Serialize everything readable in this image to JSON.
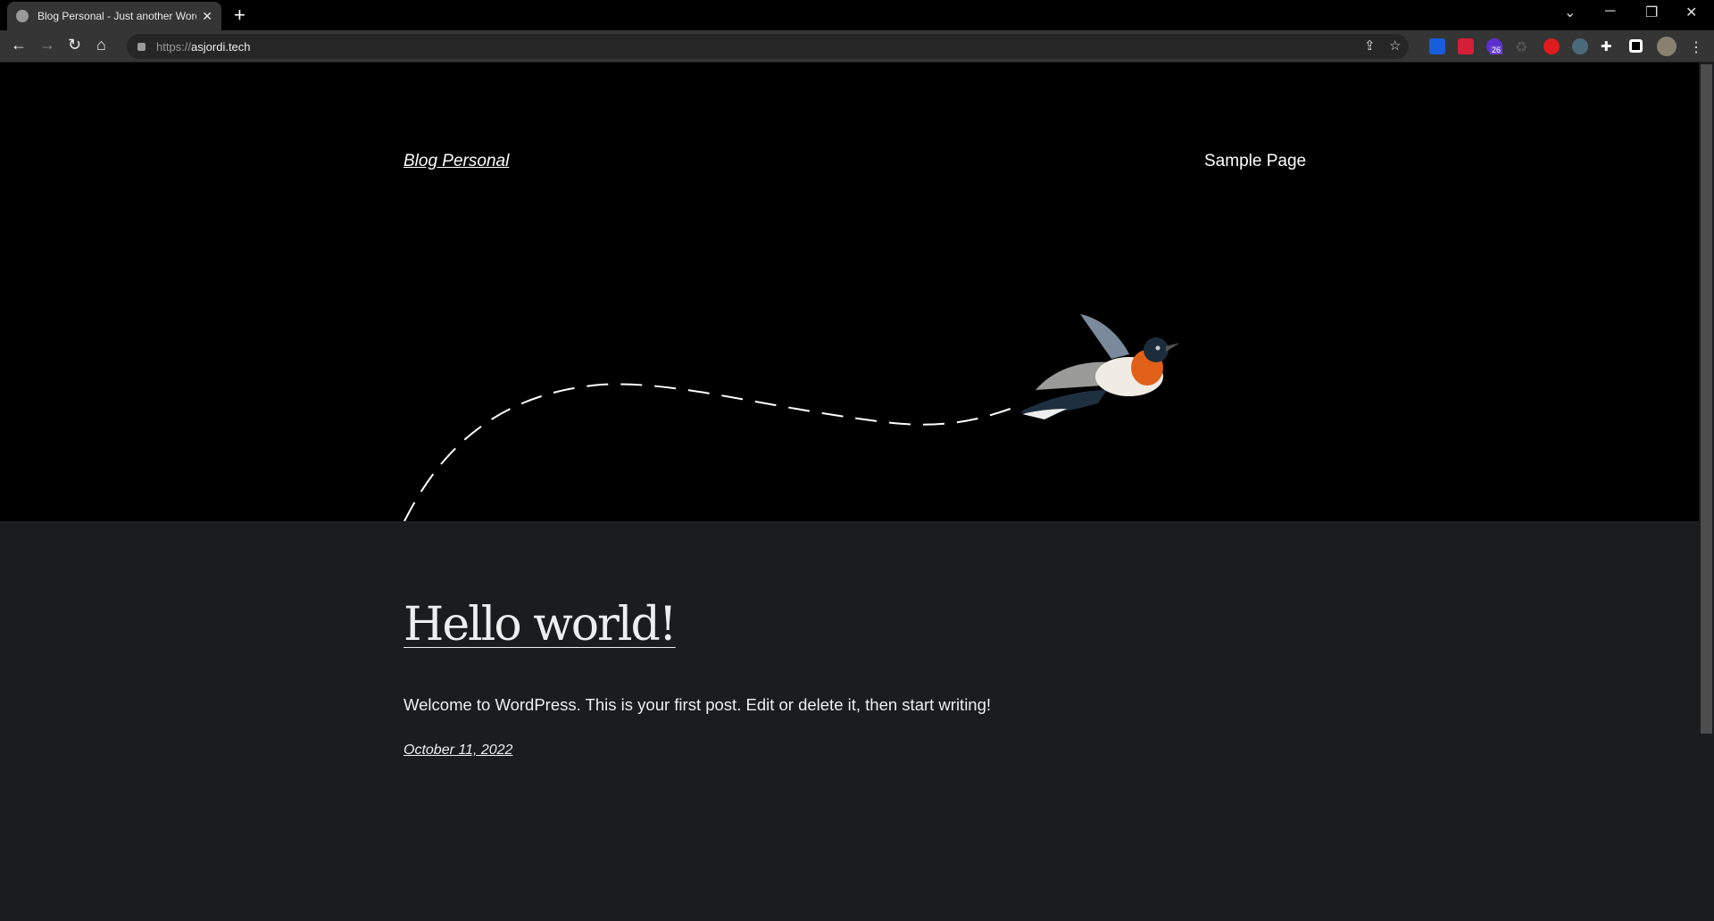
{
  "browser": {
    "tab_title": "Blog Personal - Just another WordPress site",
    "url_protocol": "https://",
    "url_host": "asjordi.tech",
    "extension_badge": "26",
    "extensions": [
      "bitwarden-icon",
      "mendeley-icon",
      "purple-extension-icon",
      "recycle-icon",
      "adblock-hand-icon",
      "glasses-icon"
    ],
    "extension_colors": [
      "#175ddc",
      "#d51f38",
      "#5a2ecf",
      "#444444",
      "#e01b1b",
      "#4a6a7a"
    ]
  },
  "site": {
    "title": "Blog Personal",
    "nav": [
      {
        "label": "Sample Page"
      }
    ]
  },
  "post": {
    "title": "Hello world!",
    "excerpt": "Welcome to WordPress. This is your first post. Edit or delete it, then start writing!",
    "date": "October 11, 2022"
  },
  "colors": {
    "header_bg": "#000000",
    "body_bg": "#1b1c1e",
    "text": "#ffffff"
  }
}
